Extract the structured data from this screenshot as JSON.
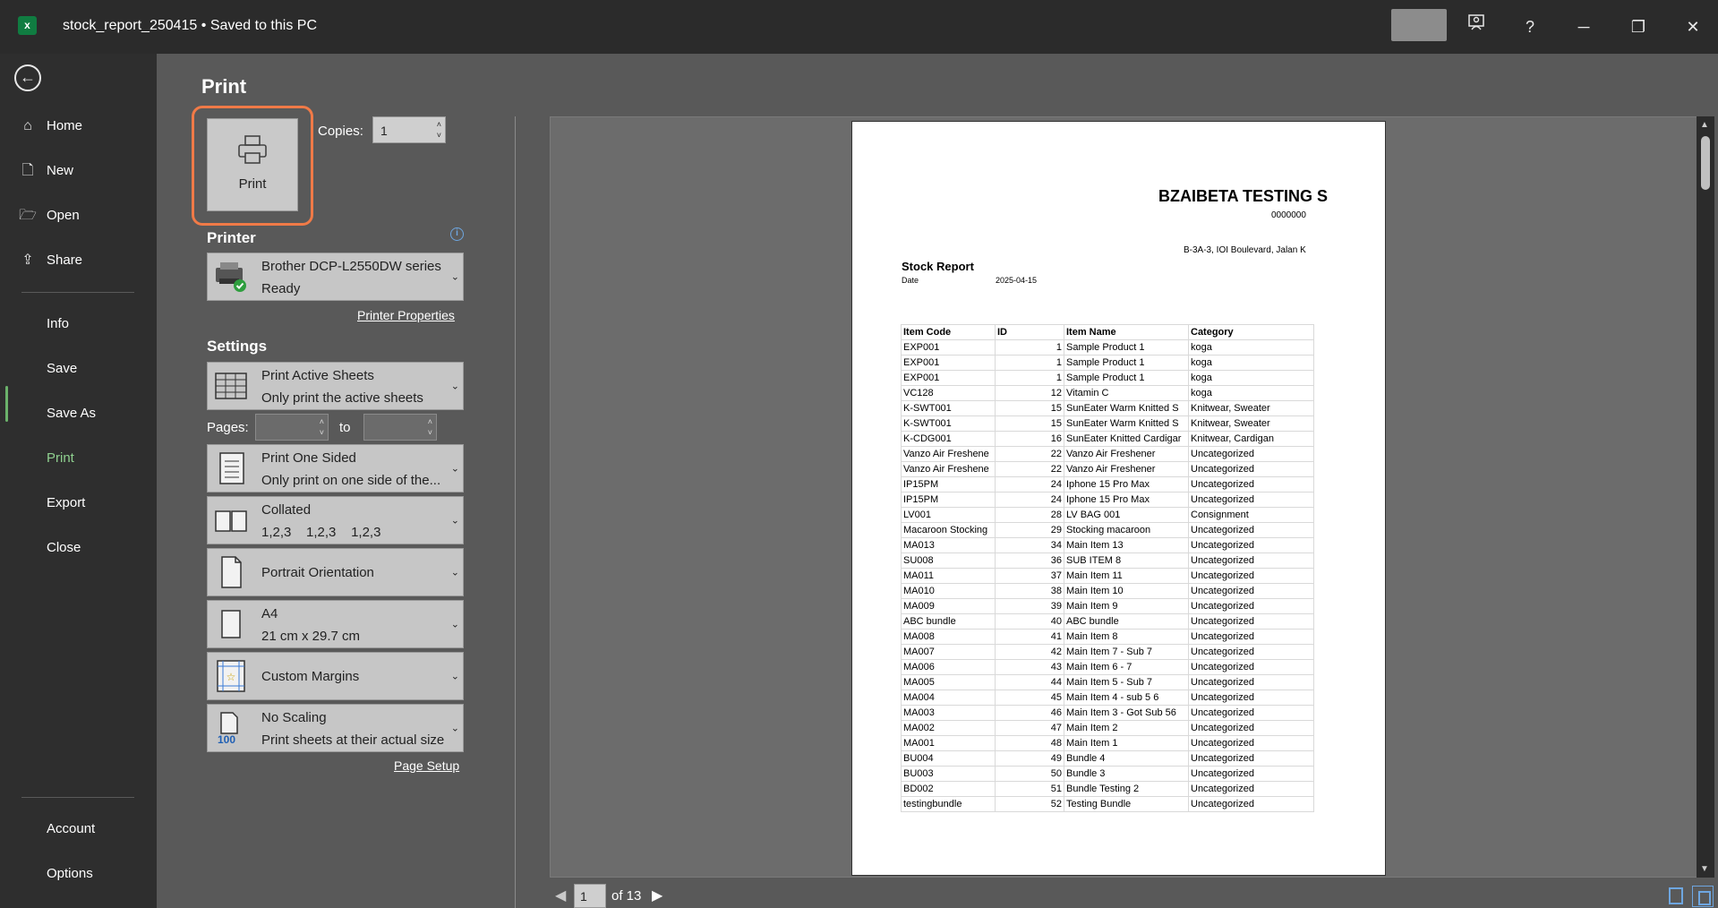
{
  "window": {
    "app_icon": "excel-icon",
    "title": "stock_report_250415  •  Saved to this PC",
    "buttons": {
      "coaching": "coaching-icon",
      "help": "?",
      "minimize": "─",
      "restore": "❐",
      "close": "✕"
    }
  },
  "sidebar": {
    "back": "←",
    "items": [
      {
        "label": "Home",
        "icon": "home-icon"
      },
      {
        "label": "New",
        "icon": "new-document-icon"
      },
      {
        "label": "Open",
        "icon": "folder-open-icon"
      },
      {
        "label": "Share",
        "icon": "share-icon"
      },
      {
        "label": "Info"
      },
      {
        "label": "Save"
      },
      {
        "label": "Save As"
      },
      {
        "label": "Print",
        "selected": true
      },
      {
        "label": "Export"
      },
      {
        "label": "Close"
      },
      {
        "label": "Account"
      },
      {
        "label": "Options"
      }
    ],
    "accent": "#6bb26b"
  },
  "print_panel": {
    "title": "Print",
    "print_button_label": "Print",
    "copies_label": "Copies:",
    "copies_value": "1",
    "printer_heading": "Printer",
    "printer_name": "Brother DCP-L2550DW series",
    "printer_status": "Ready",
    "printer_properties": "Printer Properties",
    "settings_heading": "Settings",
    "settings": [
      {
        "line1": "Print Active Sheets",
        "line2": "Only print the active sheets",
        "icon": "sheets-grid-icon"
      },
      {
        "line1": "Print One Sided",
        "line2": "Only print on one side of the...",
        "icon": "one-sided-icon"
      },
      {
        "line1": "Collated",
        "line2": "1,2,3    1,2,3    1,2,3",
        "icon": "collated-icon"
      },
      {
        "line1": "Portrait Orientation",
        "icon": "portrait-icon"
      },
      {
        "line1": "A4",
        "line2": "21 cm x 29.7 cm",
        "icon": "paper-size-icon"
      },
      {
        "line1": "Custom Margins",
        "icon": "margins-icon"
      },
      {
        "line1": "No Scaling",
        "line2": "Print sheets at their actual size",
        "icon": "scaling-icon",
        "badge": "100"
      }
    ],
    "pages_label": "Pages:",
    "to_label": "to",
    "page_setup": "Page Setup",
    "highlight_color": "#f07a47"
  },
  "preview": {
    "company": "BZAIBETA TESTING S",
    "company_no": "0000000",
    "address": "B-3A-3, IOI Boulevard, Jalan K",
    "report_title": "Stock Report",
    "date_label": "Date",
    "date_value": "2025-04-15",
    "columns": [
      "Item Code",
      "ID",
      "Item Name",
      "Category"
    ],
    "rows": [
      [
        "EXP001",
        "1",
        "Sample Product 1",
        "koga"
      ],
      [
        "EXP001",
        "1",
        "Sample Product 1",
        "koga"
      ],
      [
        "EXP001",
        "1",
        "Sample Product 1",
        "koga"
      ],
      [
        "VC128",
        "12",
        "Vitamin C",
        "koga"
      ],
      [
        "K-SWT001",
        "15",
        "SunEater Warm Knitted S",
        "Knitwear, Sweater"
      ],
      [
        "K-SWT001",
        "15",
        "SunEater Warm Knitted S",
        "Knitwear, Sweater"
      ],
      [
        "K-CDG001",
        "16",
        "SunEater Knitted Cardigar",
        "Knitwear, Cardigan"
      ],
      [
        "Vanzo Air Freshene",
        "22",
        "Vanzo Air Freshener",
        "Uncategorized"
      ],
      [
        "Vanzo Air Freshene",
        "22",
        "Vanzo Air Freshener",
        "Uncategorized"
      ],
      [
        "IP15PM",
        "24",
        "Iphone 15 Pro Max",
        "Uncategorized"
      ],
      [
        "IP15PM",
        "24",
        "Iphone 15 Pro Max",
        "Uncategorized"
      ],
      [
        "LV001",
        "28",
        "LV BAG 001",
        "Consignment"
      ],
      [
        "Macaroon Stocking",
        "29",
        "Stocking macaroon",
        "Uncategorized"
      ],
      [
        "MA013",
        "34",
        "Main Item 13",
        "Uncategorized"
      ],
      [
        "SU008",
        "36",
        "SUB ITEM 8",
        "Uncategorized"
      ],
      [
        "MA011",
        "37",
        "Main Item 11",
        "Uncategorized"
      ],
      [
        "MA010",
        "38",
        "Main Item 10",
        "Uncategorized"
      ],
      [
        "MA009",
        "39",
        "Main Item 9",
        "Uncategorized"
      ],
      [
        "ABC bundle",
        "40",
        "ABC bundle",
        "Uncategorized"
      ],
      [
        "MA008",
        "41",
        "Main Item 8",
        "Uncategorized"
      ],
      [
        "MA007",
        "42",
        "Main Item 7 - Sub 7",
        "Uncategorized"
      ],
      [
        "MA006",
        "43",
        "Main Item 6 - 7",
        "Uncategorized"
      ],
      [
        "MA005",
        "44",
        "Main Item 5 - Sub 7",
        "Uncategorized"
      ],
      [
        "MA004",
        "45",
        "Main Item 4 - sub 5 6",
        "Uncategorized"
      ],
      [
        "MA003",
        "46",
        "Main Item 3 - Got Sub 56",
        "Uncategorized"
      ],
      [
        "MA002",
        "47",
        "Main Item 2",
        "Uncategorized"
      ],
      [
        "MA001",
        "48",
        "Main Item 1",
        "Uncategorized"
      ],
      [
        "BU004",
        "49",
        "Bundle 4",
        "Uncategorized"
      ],
      [
        "BU003",
        "50",
        "Bundle 3",
        "Uncategorized"
      ],
      [
        "BD002",
        "51",
        "Bundle Testing 2",
        "Uncategorized"
      ],
      [
        "testingbundle",
        "52",
        "Testing Bundle",
        "Uncategorized"
      ]
    ],
    "current_page": "1",
    "of_pages": "of 13"
  }
}
